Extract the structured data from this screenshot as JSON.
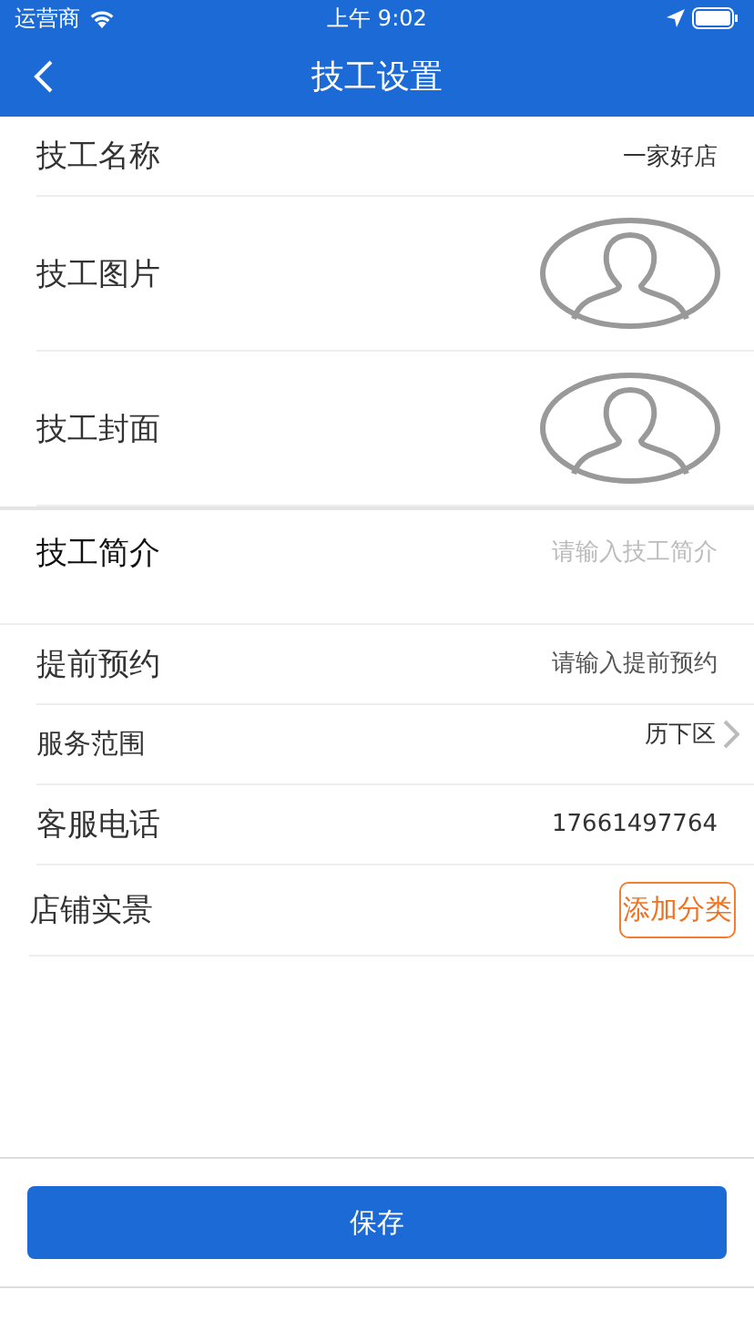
{
  "status_bar": {
    "carrier": "运营商",
    "time": "上午 9:02"
  },
  "header": {
    "title": "技工设置"
  },
  "rows": [
    {
      "kind": "value",
      "label": "技工名称",
      "value": "一家好店"
    },
    {
      "kind": "avatar",
      "label": "技工图片"
    },
    {
      "kind": "avatar",
      "label": "技工封面"
    },
    {
      "kind": "textarea",
      "label": "技工简介",
      "placeholder": "请输入技工简介"
    },
    {
      "kind": "input",
      "label": "提前预约",
      "placeholder": "请输入提前预约"
    },
    {
      "kind": "link",
      "label": "服务范围",
      "value": "历下区"
    },
    {
      "kind": "value",
      "label": "客服电话",
      "value": "17661497764"
    },
    {
      "kind": "button",
      "label": "店铺实景",
      "button": "添加分类"
    }
  ],
  "save_button": "保存"
}
